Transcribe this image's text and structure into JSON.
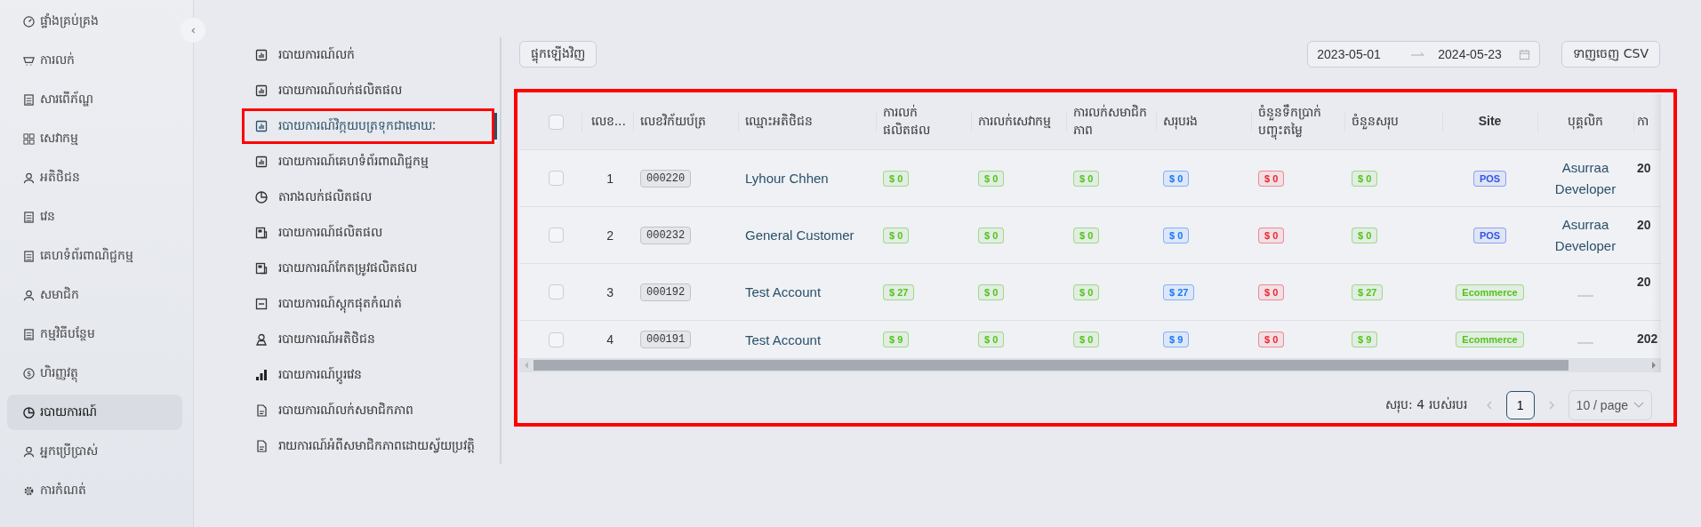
{
  "sidebar": {
    "items": [
      {
        "label": "ផ្ទាំងគ្រប់គ្រង",
        "selected": false
      },
      {
        "label": "ការលក់",
        "selected": false
      },
      {
        "label": "សារពើភ័ណ្ឌ",
        "selected": false
      },
      {
        "label": "សេវាកម្ម",
        "selected": false
      },
      {
        "label": "អតិថិជន",
        "selected": false
      },
      {
        "label": "វេន",
        "selected": false
      },
      {
        "label": "គេហទំព័រពាណិជ្ជកម្ម",
        "selected": false
      },
      {
        "label": "សមាជិក",
        "selected": false
      },
      {
        "label": "កម្មវិធីបន្ថែម",
        "selected": false
      },
      {
        "label": "ហិរញ្ញវត្ថុ",
        "selected": false
      },
      {
        "label": "របាយការណ៍",
        "selected": true
      },
      {
        "label": "អ្នកប្រើប្រាស់",
        "selected": false
      },
      {
        "label": "ការកំណត់",
        "selected": false
      }
    ]
  },
  "report_menu": {
    "items": [
      {
        "label": "របាយការណ៍លក់",
        "selected": false,
        "highlighted": false
      },
      {
        "label": "របាយការណ៍លក់ផលិតផល",
        "selected": false,
        "highlighted": false
      },
      {
        "label": "របាយការណ៍វិក្កយបត្រទុកជាមោឃៈ",
        "selected": true,
        "highlighted": true
      },
      {
        "label": "របាយការណ៍គេហទំព័រពាណិជ្ជកម្ម",
        "selected": false,
        "highlighted": false
      },
      {
        "label": "តារាងលក់ផលិតផល",
        "selected": false,
        "highlighted": false
      },
      {
        "label": "របាយការណ៍ផលិតផល",
        "selected": false,
        "highlighted": false
      },
      {
        "label": "របាយការណ៍កែតម្រូវផលិតផល",
        "selected": false,
        "highlighted": false
      },
      {
        "label": "របាយការណ៍ស្តុកផុតកំណត់",
        "selected": false,
        "highlighted": false
      },
      {
        "label": "របាយការណ៍អតិថិជន",
        "selected": false,
        "highlighted": false
      },
      {
        "label": "របាយការណ៍ប្តូរវេន",
        "selected": false,
        "highlighted": false
      },
      {
        "label": "របាយការណ៍លក់សមាជិកភាព",
        "selected": false,
        "highlighted": false
      },
      {
        "label": "រាយការណ៍អំពីសមាជិកភាពដោយស្វ័យប្រវត្តិ",
        "selected": false,
        "highlighted": false
      }
    ]
  },
  "toolbar": {
    "reload_button": "ផ្ទុកឡើងវិញ",
    "date_from": "2023-05-01",
    "date_to": "2024-05-23",
    "export_button": "ទាញចេញ CSV"
  },
  "table": {
    "highlighted": true,
    "columns": [
      {
        "kind": "check",
        "checked": false
      },
      {
        "kind": "index",
        "label": "លេខ..."
      },
      {
        "kind": "code",
        "label": "លេខវិក័យប័ត្រ"
      },
      {
        "kind": "name",
        "label": "ឈ្មោះអតិថិជន"
      },
      {
        "kind": "amount",
        "label": "ការលក់ផលិតផល",
        "color": "#52c41a"
      },
      {
        "kind": "amount",
        "label": "ការលក់សេវាកម្ម",
        "color": "#52c41a"
      },
      {
        "kind": "amount",
        "label": "ការលក់សមាជិកភាព",
        "color": "#52c41a"
      },
      {
        "kind": "amount",
        "label": "សរុបរង",
        "color": "#1677ff"
      },
      {
        "kind": "amount",
        "label": "ចំនួនទឹកប្រាក់បញ្ចុះតម្លៃ",
        "color": "#f5222d"
      },
      {
        "kind": "amount",
        "label": "ចំនួនសរុប",
        "color": "#52c41a"
      },
      {
        "kind": "site",
        "label": "Site"
      },
      {
        "kind": "staff",
        "label": "បុគ្គលិក"
      },
      {
        "kind": "date",
        "label": "កា"
      }
    ],
    "rows": [
      {
        "checked": false,
        "cells": [
          null,
          "1",
          "000220",
          "Lyhour Chhen",
          "$ 0",
          "$ 0",
          "$ 0",
          "$ 0",
          "$ 0",
          "$ 0",
          {
            "text": "POS",
            "color": "#2f54eb"
          },
          "Asurraa Developer",
          "20"
        ]
      },
      {
        "checked": false,
        "cells": [
          null,
          "2",
          "000232",
          "General Customer",
          "$ 0",
          "$ 0",
          "$ 0",
          "$ 0",
          "$ 0",
          "$ 0",
          {
            "text": "POS",
            "color": "#2f54eb"
          },
          "Asurraa Developer",
          "20"
        ]
      },
      {
        "checked": false,
        "cells": [
          null,
          "3",
          "000192",
          "Test Account",
          "$ 27",
          "$ 0",
          "$ 0",
          "$ 27",
          "$ 0",
          "$ 27",
          {
            "text": "Ecommerce",
            "color": "#52c41a"
          },
          null,
          "20"
        ]
      },
      {
        "checked": false,
        "cells": [
          null,
          "4",
          "000191",
          "Test Account",
          "$ 9",
          "$ 0",
          "$ 0",
          "$ 9",
          "$ 0",
          "$ 9",
          {
            "text": "Ecommerce",
            "color": "#52c41a"
          },
          null,
          "202"
        ]
      }
    ]
  },
  "pagination": {
    "total": "សរុប: 4 របស់របរ",
    "pages": [
      {
        "label": "1",
        "selected": true
      }
    ],
    "page_size": "10 / page"
  }
}
